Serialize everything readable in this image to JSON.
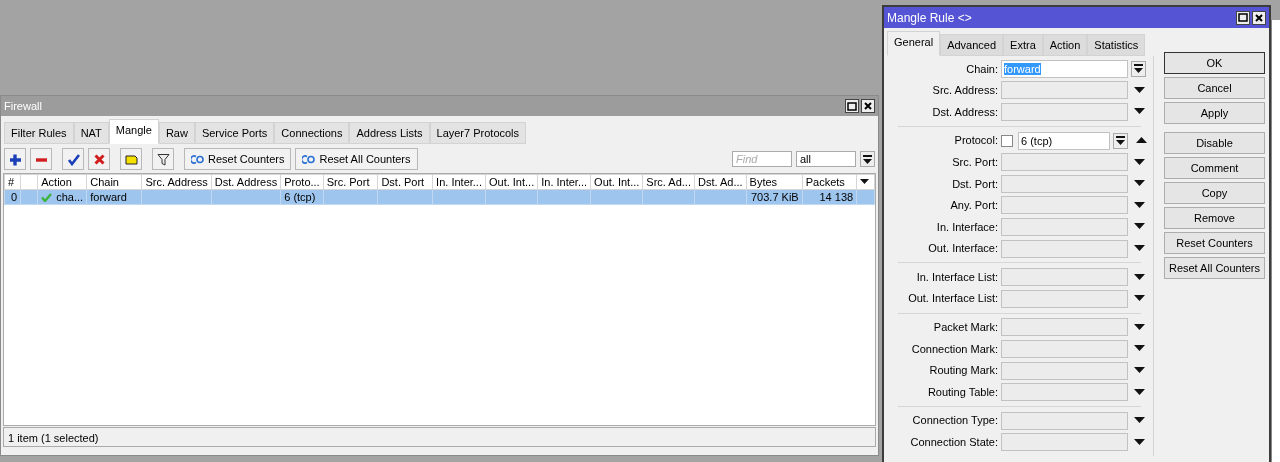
{
  "firewall": {
    "title": "Firewall",
    "tabs": [
      {
        "label": "Filter Rules",
        "selected": false
      },
      {
        "label": "NAT",
        "selected": false
      },
      {
        "label": "Mangle",
        "selected": true
      },
      {
        "label": "Raw",
        "selected": false
      },
      {
        "label": "Service Ports",
        "selected": false
      },
      {
        "label": "Connections",
        "selected": false
      },
      {
        "label": "Address Lists",
        "selected": false
      },
      {
        "label": "Layer7 Protocols",
        "selected": false
      }
    ],
    "toolbar": {
      "text_buttons": [
        "Reset Counters",
        "Reset All Counters"
      ],
      "find": {
        "placeholder": "Find"
      },
      "filter": {
        "value": "all"
      }
    },
    "table": {
      "columns": [
        "#",
        "",
        "Action",
        "Chain",
        "Src. Address",
        "Dst. Address",
        "Proto...",
        "Src. Port",
        "Dst. Port",
        "In. Inter...",
        "Out. Int...",
        "In. Inter...",
        "Out. Int...",
        "Src. Ad...",
        "Dst. Ad...",
        "Bytes",
        "Packets"
      ],
      "rows": [
        {
          "selected": true,
          "enabled": true,
          "cells": [
            "0",
            "",
            "cha...",
            "forward",
            "",
            "",
            "6 (tcp)",
            "",
            "",
            "",
            "",
            "",
            "",
            "",
            "",
            "703.7 KiB",
            "14 138"
          ]
        }
      ]
    },
    "status_bar": "1 item (1 selected)"
  },
  "dialog": {
    "title": "Mangle Rule <>",
    "tabs": [
      {
        "label": "General",
        "selected": true
      },
      {
        "label": "Advanced",
        "selected": false
      },
      {
        "label": "Extra",
        "selected": false
      },
      {
        "label": "Action",
        "selected": false
      },
      {
        "label": "Statistics",
        "selected": false
      }
    ],
    "sections": [
      [
        {
          "kind": "select",
          "label": "Chain:",
          "value": "forward",
          "highlighted": true
        },
        {
          "kind": "dropdown",
          "label": "Src. Address:",
          "expanded": false
        },
        {
          "kind": "dropdown",
          "label": "Dst. Address:",
          "expanded": false
        }
      ],
      [
        {
          "kind": "protocol",
          "label": "Protocol:",
          "value": "6 (tcp)",
          "checked": false,
          "expanded": true
        },
        {
          "kind": "dropdown",
          "label": "Src. Port:",
          "expanded": false
        },
        {
          "kind": "dropdown",
          "label": "Dst. Port:",
          "expanded": false
        },
        {
          "kind": "dropdown",
          "label": "Any. Port:",
          "expanded": false
        },
        {
          "kind": "dropdown",
          "label": "In. Interface:",
          "expanded": false
        },
        {
          "kind": "dropdown",
          "label": "Out. Interface:",
          "expanded": false
        }
      ],
      [
        {
          "kind": "dropdown",
          "label": "In. Interface List:",
          "expanded": false
        },
        {
          "kind": "dropdown",
          "label": "Out. Interface List:",
          "expanded": false
        }
      ],
      [
        {
          "kind": "dropdown",
          "label": "Packet Mark:",
          "expanded": false
        },
        {
          "kind": "dropdown",
          "label": "Connection Mark:",
          "expanded": false
        },
        {
          "kind": "dropdown",
          "label": "Routing Mark:",
          "expanded": false
        },
        {
          "kind": "dropdown",
          "label": "Routing Table:",
          "expanded": false
        }
      ],
      [
        {
          "kind": "dropdown",
          "label": "Connection Type:",
          "expanded": false
        },
        {
          "kind": "dropdown",
          "label": "Connection State:",
          "expanded": false
        }
      ]
    ],
    "buttons": [
      {
        "label": "OK",
        "default": true
      },
      {
        "label": "Cancel",
        "default": false
      },
      {
        "label": "Apply",
        "default": false
      },
      {
        "label": "Disable",
        "default": false
      },
      {
        "label": "Comment",
        "default": false
      },
      {
        "label": "Copy",
        "default": false
      },
      {
        "label": "Remove",
        "default": false
      },
      {
        "label": "Reset Counters",
        "default": false
      },
      {
        "label": "Reset All Counters",
        "default": false
      }
    ]
  }
}
